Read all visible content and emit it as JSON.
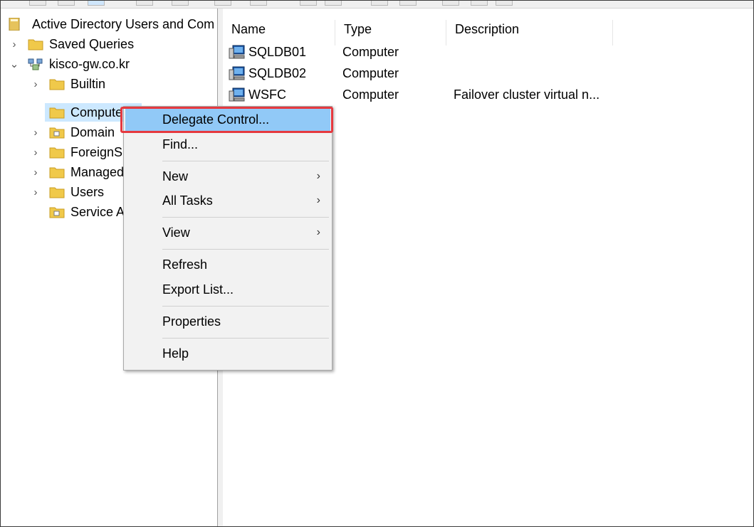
{
  "tree": {
    "root_label": "Active Directory Users and Com",
    "items": [
      {
        "label": "Saved Queries",
        "chevron": "›"
      },
      {
        "label": "kisco-gw.co.kr",
        "chevron": "⌄"
      },
      {
        "label": "Builtin",
        "chevron": "›"
      },
      {
        "label": "Computers",
        "chevron": ""
      },
      {
        "label": "Domain",
        "chevron": "›"
      },
      {
        "label": "ForeignS",
        "chevron": "›"
      },
      {
        "label": "Managed",
        "chevron": "›"
      },
      {
        "label": "Users",
        "chevron": "›"
      },
      {
        "label": "Service A",
        "chevron": ""
      }
    ]
  },
  "list": {
    "columns": [
      "Name",
      "Type",
      "Description"
    ],
    "rows": [
      {
        "name": "SQLDB01",
        "type": "Computer",
        "description": ""
      },
      {
        "name": "SQLDB02",
        "type": "Computer",
        "description": ""
      },
      {
        "name": "WSFC",
        "type": "Computer",
        "description": "Failover cluster virtual n..."
      }
    ]
  },
  "context_menu": {
    "items": [
      {
        "label": "Delegate Control...",
        "submenu": ""
      },
      {
        "label": "Find...",
        "submenu": ""
      },
      {
        "label": "New",
        "submenu": "›"
      },
      {
        "label": "All Tasks",
        "submenu": "›"
      },
      {
        "label": "View",
        "submenu": "›"
      },
      {
        "label": "Refresh",
        "submenu": ""
      },
      {
        "label": "Export List...",
        "submenu": ""
      },
      {
        "label": "Properties",
        "submenu": ""
      },
      {
        "label": "Help",
        "submenu": ""
      }
    ]
  },
  "colors": {
    "menu_highlight": "#91c9f7",
    "annotation_box": "#e5393f",
    "folder_yellow": "#f0c94a"
  }
}
